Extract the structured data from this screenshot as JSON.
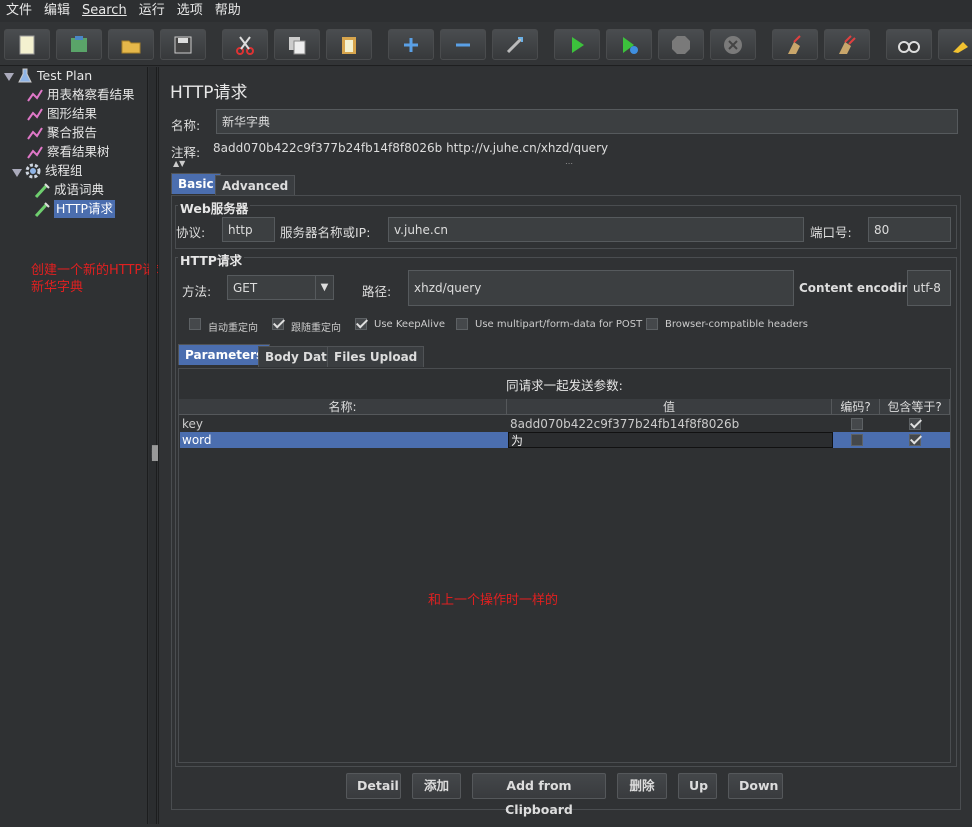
{
  "menubar": {
    "items": [
      "文件",
      "编辑",
      "Search",
      "运行",
      "选项",
      "帮助"
    ]
  },
  "toolbar": {
    "buttons": [
      "new-icon",
      "templates-icon",
      "open-icon",
      "save-icon",
      "cut-icon",
      "copy-icon",
      "paste-icon",
      "expand-icon",
      "collapse-icon",
      "toggle-icon",
      "start-icon",
      "start-no-pause-icon",
      "stop-icon",
      "shutdown-icon",
      "clear-icon",
      "clear-all-icon",
      "search-icon",
      "reset-search-icon"
    ]
  },
  "tree": {
    "items": [
      {
        "label": "Test Plan",
        "icon": "flask-icon"
      },
      {
        "label": "用表格察看结果",
        "icon": "chart-icon"
      },
      {
        "label": "图形结果",
        "icon": "chart-icon"
      },
      {
        "label": "聚合报告",
        "icon": "chart-icon"
      },
      {
        "label": "察看结果树",
        "icon": "chart-icon"
      },
      {
        "label": "线程组",
        "icon": "gear-icon"
      },
      {
        "label": "成语词典",
        "icon": "pipette-icon"
      },
      {
        "label": "HTTP请求",
        "icon": "pipette-icon"
      }
    ]
  },
  "annotations": {
    "left_line1": "创建一个新的HTTP请求",
    "left_line2": "新华字典",
    "center": "和上一个操作时一样的"
  },
  "main": {
    "title": "HTTP请求",
    "name_label": "名称:",
    "name_value": "新华字典",
    "comment_label": "注释:",
    "comment_value": "8add070b422c9f377b24fb14f8f8026b     http://v.juhe.cn/xhzd/query",
    "tabs": [
      "Basic",
      "Advanced"
    ],
    "web_server": {
      "title": "Web服务器",
      "protocol_label": "协议:",
      "protocol_value": "http",
      "server_label": "服务器名称或IP:",
      "server_value": "v.juhe.cn",
      "port_label": "端口号:",
      "port_value": "80"
    },
    "http_request": {
      "title": "HTTP请求",
      "method_label": "方法:",
      "method_value": "GET",
      "path_label": "路径:",
      "path_value": "xhzd/query",
      "encoding_label": "Content encoding:",
      "encoding_value": "utf-8"
    },
    "options": [
      {
        "label": "自动重定向",
        "checked": false
      },
      {
        "label": "跟随重定向",
        "checked": true
      },
      {
        "label": "Use KeepAlive",
        "checked": true
      },
      {
        "label": "Use multipart/form-data for POST",
        "checked": false
      },
      {
        "label": "Browser-compatible headers",
        "checked": false
      }
    ],
    "param_tabs": [
      "Parameters",
      "Body Data",
      "Files Upload"
    ],
    "params": {
      "caption": "同请求一起发送参数:",
      "headers": [
        "名称:",
        "值",
        "编码?",
        "包含等于?"
      ],
      "rows": [
        {
          "name": "key",
          "value": "8add070b422c9f377b24fb14f8f8026b",
          "encode": false,
          "include_equals": true
        },
        {
          "name": "word",
          "value": "为",
          "encode": false,
          "include_equals": true
        }
      ]
    },
    "buttons": [
      "Detail",
      "添加",
      "Add from Clipboard",
      "删除",
      "Up",
      "Down"
    ]
  }
}
